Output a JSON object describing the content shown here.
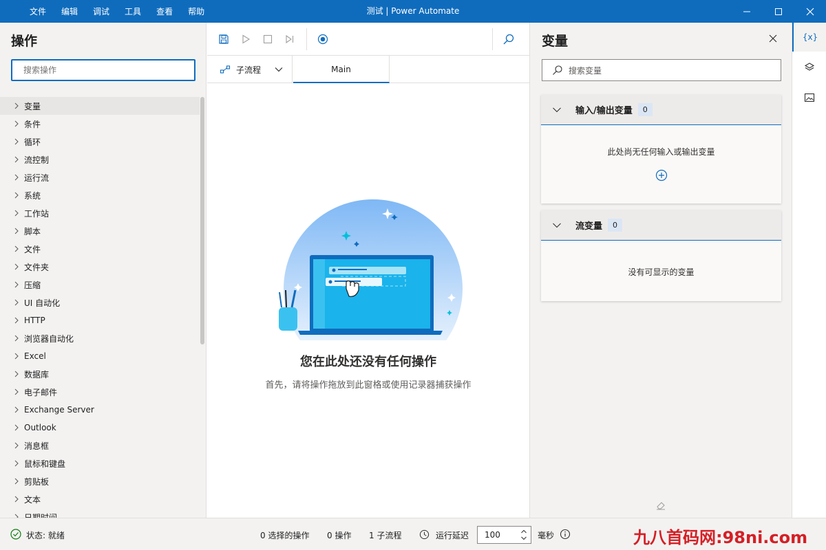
{
  "titlebar": {
    "menu": [
      "文件",
      "编辑",
      "调试",
      "工具",
      "查看",
      "帮助"
    ],
    "title": "测试 | Power Automate"
  },
  "actions_pane": {
    "title": "操作",
    "search_placeholder": "搜索操作",
    "categories": [
      "变量",
      "条件",
      "循环",
      "流控制",
      "运行流",
      "系统",
      "工作站",
      "脚本",
      "文件",
      "文件夹",
      "压缩",
      "UI 自动化",
      "HTTP",
      "浏览器自动化",
      "Excel",
      "数据库",
      "电子邮件",
      "Exchange Server",
      "Outlook",
      "消息框",
      "鼠标和键盘",
      "剪贴板",
      "文本",
      "日期时间"
    ]
  },
  "designer": {
    "subflow_label": "子流程",
    "main_tab": "Main",
    "empty_title": "您在此处还没有任何操作",
    "empty_subtitle": "首先，请将操作拖放到此窗格或使用记录器捕获操作"
  },
  "variables_pane": {
    "title": "变量",
    "search_placeholder": "搜索变量",
    "io_section": {
      "title": "输入/输出变量",
      "count": "0",
      "empty_text": "此处尚无任何输入或输出变量"
    },
    "flow_section": {
      "title": "流变量",
      "count": "0",
      "empty_text": "没有可显示的变量"
    }
  },
  "right_strip": {
    "variables_icon_text": "{x}"
  },
  "statusbar": {
    "status": "状态: 就绪",
    "selected_actions": "0 选择的操作",
    "actions": "0 操作",
    "subflows": "1 子流程",
    "run_delay_label": "运行延迟",
    "run_delay_value": "100",
    "unit": "毫秒"
  },
  "watermark": "九八首码网:98ni.com",
  "colors": {
    "accent": "#0f6cbd",
    "pane_bg": "#f3f2f1",
    "watermark": "#d51f25"
  }
}
